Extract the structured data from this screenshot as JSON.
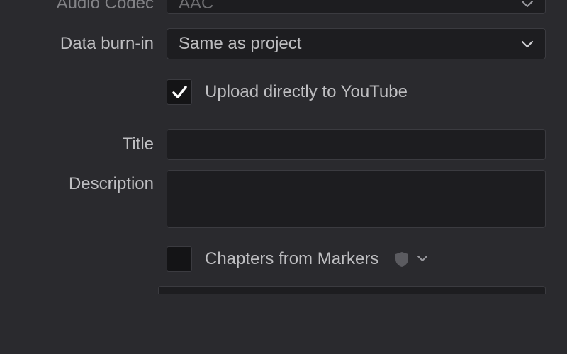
{
  "fields": {
    "audio_codec": {
      "label": "Audio Codec",
      "value": "AAC"
    },
    "data_burn_in": {
      "label": "Data burn-in",
      "value": "Same as project"
    },
    "upload_youtube": {
      "label": "Upload directly to YouTube",
      "checked": true
    },
    "title": {
      "label": "Title",
      "value": ""
    },
    "description": {
      "label": "Description",
      "value": ""
    },
    "chapters_from_markers": {
      "label": "Chapters from Markers",
      "checked": false
    }
  }
}
